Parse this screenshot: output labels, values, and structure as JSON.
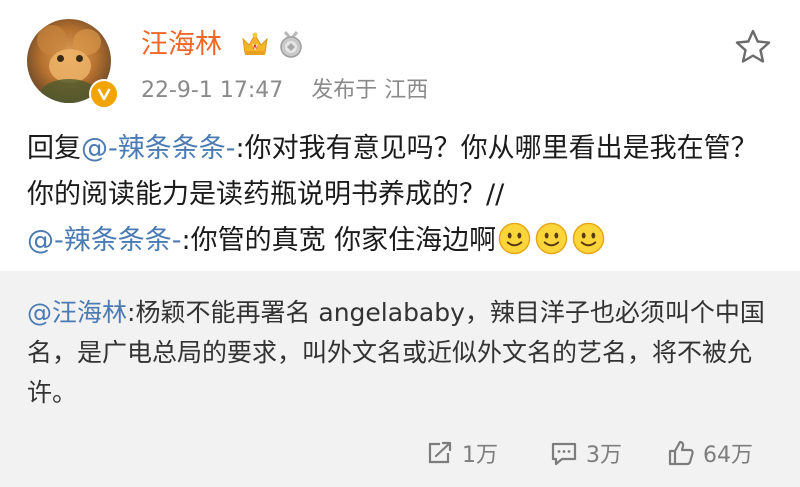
{
  "user": {
    "name": "汪海林",
    "timestamp": "22-9-1 17:47",
    "source": "发布于 江西"
  },
  "post": {
    "prefix": "回复",
    "mention1": "@-辣条条条-",
    "text1": ":你对我有意见吗？你从哪里看出是我在管？你的阅读能力是读药瓶说明书养成的？//",
    "mention2": "@-辣条条条-",
    "text2": ":你管的真宽  你家住海边啊"
  },
  "quote": {
    "mention": "@汪海林",
    "text": ":杨颖不能再署名 angelababy，辣目洋子也必须叫个中国名，是广电总局的要求，叫外文名或近似外文名的艺名，将不被允许。"
  },
  "actions": {
    "repost_count": "1万",
    "comment_count": "3万",
    "like_count": "64万"
  },
  "colors": {
    "username": "#f1672a",
    "mention": "#4c7bb3",
    "quote_bg": "#f2f2f2",
    "meta": "#8a8a8a"
  },
  "icons": {
    "crown": "crown-icon",
    "medal": "medal-icon",
    "favorite": "star-icon",
    "verified": "verified-badge-icon",
    "emoji": "smile-emoji-icon",
    "repost": "repost-icon",
    "comment": "comment-icon",
    "like": "like-icon"
  }
}
